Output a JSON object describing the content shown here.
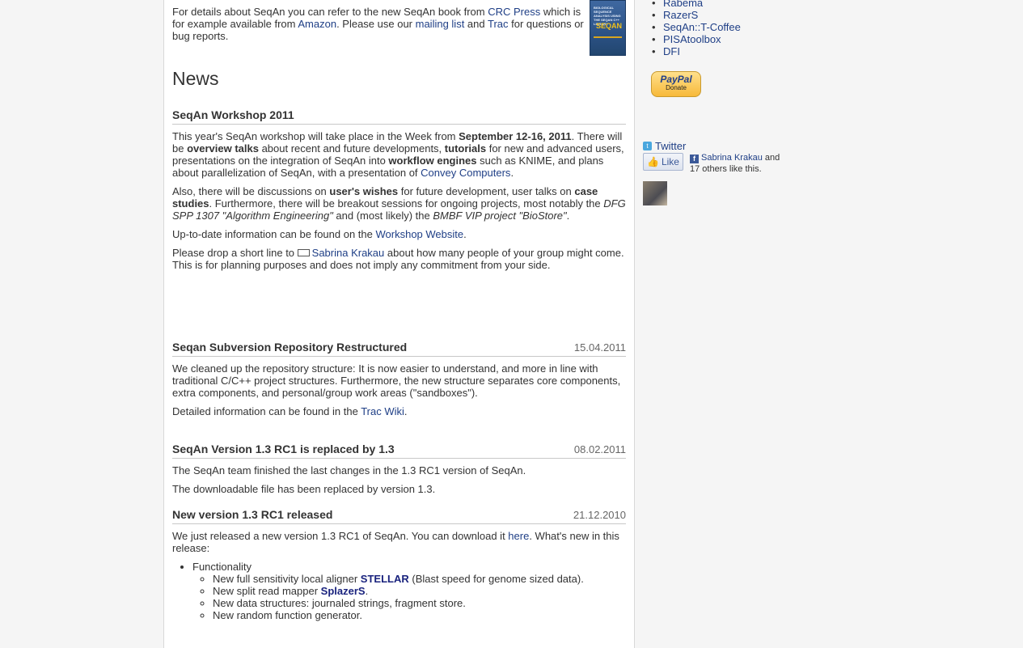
{
  "intro": {
    "t1": "For details about SeqAn you can refer to the new SeqAn book from ",
    "crc_link": "CRC Press",
    "t2": " which is for example available from ",
    "amazon_link": "Amazon",
    "t3": ". Please use our ",
    "mailing_link": "mailing list",
    "t4": " and ",
    "trac_link": "Trac",
    "t5": " for questions or bug reports.",
    "book_cover_text": "BIOLOGICAL SEQUENCE ANALYSIS USING THE SEQAN C++ LIBRARY",
    "book_logo": "SEQAN"
  },
  "news_heading": "News",
  "workshop": {
    "title": "SeqAn Workshop 2011",
    "p1": {
      "a": "This year's SeqAn workshop will take place in the Week from ",
      "b": "September 12-16, 2011",
      "c": ". There will be ",
      "d": "overview talks",
      "e": " about recent and future developments, ",
      "f": "tutorials",
      "g": " for new and advanced users, presentations on the integration of SeqAn into ",
      "h": "workflow engines",
      "i": " such as KNIME, and plans about parallelization of SeqAn, with a presentation of ",
      "link": "Convey Computers",
      "j": "."
    },
    "p2": {
      "a": "Also, there will be discussions on ",
      "b": "user's wishes",
      "c": " for future development, user talks on ",
      "d": "case studies",
      "e": ". Furthermore, there will be breakout sessions for ongoing projects, most notably the ",
      "f": "DFG SPP 1307 \"Algorithm Engineering\"",
      "g": " and (most likely) the ",
      "h": "BMBF VIP project \"BioStore\"",
      "i": "."
    },
    "p3": {
      "a": "Up-to-date information can be found on the ",
      "link": "Workshop Website",
      "b": "."
    },
    "p4": {
      "a": "Please drop a short line to ",
      "link": "Sabrina Krakau",
      "b": " about how many people of your group might come. This is for planning purposes and does not imply any commitment from your side."
    }
  },
  "svn": {
    "title": "Seqan Subversion Repository Restructured",
    "date": "15.04.2011",
    "p1": "We cleaned up the repository structure: It is now easier to understand, and more in line with traditional C/C++ project structures. Furthermore, the new structure separates core components, extra components, and personal/group work areas (\"sandboxes\").",
    "p2a": "Detailed information can be found in the ",
    "p2link": "Trac Wiki",
    "p2b": "."
  },
  "v13": {
    "title": "SeqAn Version 1.3 RC1 is replaced by 1.3",
    "date": "08.02.2011",
    "p1": "The SeqAn team finished the last changes in the 1.3 RC1 version of SeqAn.",
    "p2": "The downloadable file has been replaced by version 1.3."
  },
  "rc1": {
    "title": "New version 1.3 RC1 released",
    "date": "21.12.2010",
    "p1a": "We just released a new version 1.3 RC1 of SeqAn. You can download it ",
    "p1link": "here",
    "p1b": ". What's new in this release:",
    "func": "Functionality",
    "sub": {
      "s1a": "New full sensitivity local aligner ",
      "s1link": "STELLAR",
      "s1b": " (Blast speed for genome sized data).",
      "s2a": "New split read mapper ",
      "s2link": "SplazerS",
      "s2b": ".",
      "s3": "New data structures: journaled strings, fragment store.",
      "s4": "New random function generator."
    }
  },
  "sidebar": {
    "tools": [
      "Rabema",
      "RazerS",
      "SeqAn::T-Coffee",
      "PISAtoolbox",
      "DFI"
    ],
    "paypal_logo": "PayPal",
    "paypal_label": "Donate",
    "twitter": "Twitter",
    "like_label": "Like",
    "fb_name": "Sabrina Krakau",
    "fb_and": " and",
    "fb_others": "17 others like this."
  },
  "colors": {
    "link": "#1f3f86",
    "background": "#f5f5f5",
    "page": "#ffffff"
  }
}
